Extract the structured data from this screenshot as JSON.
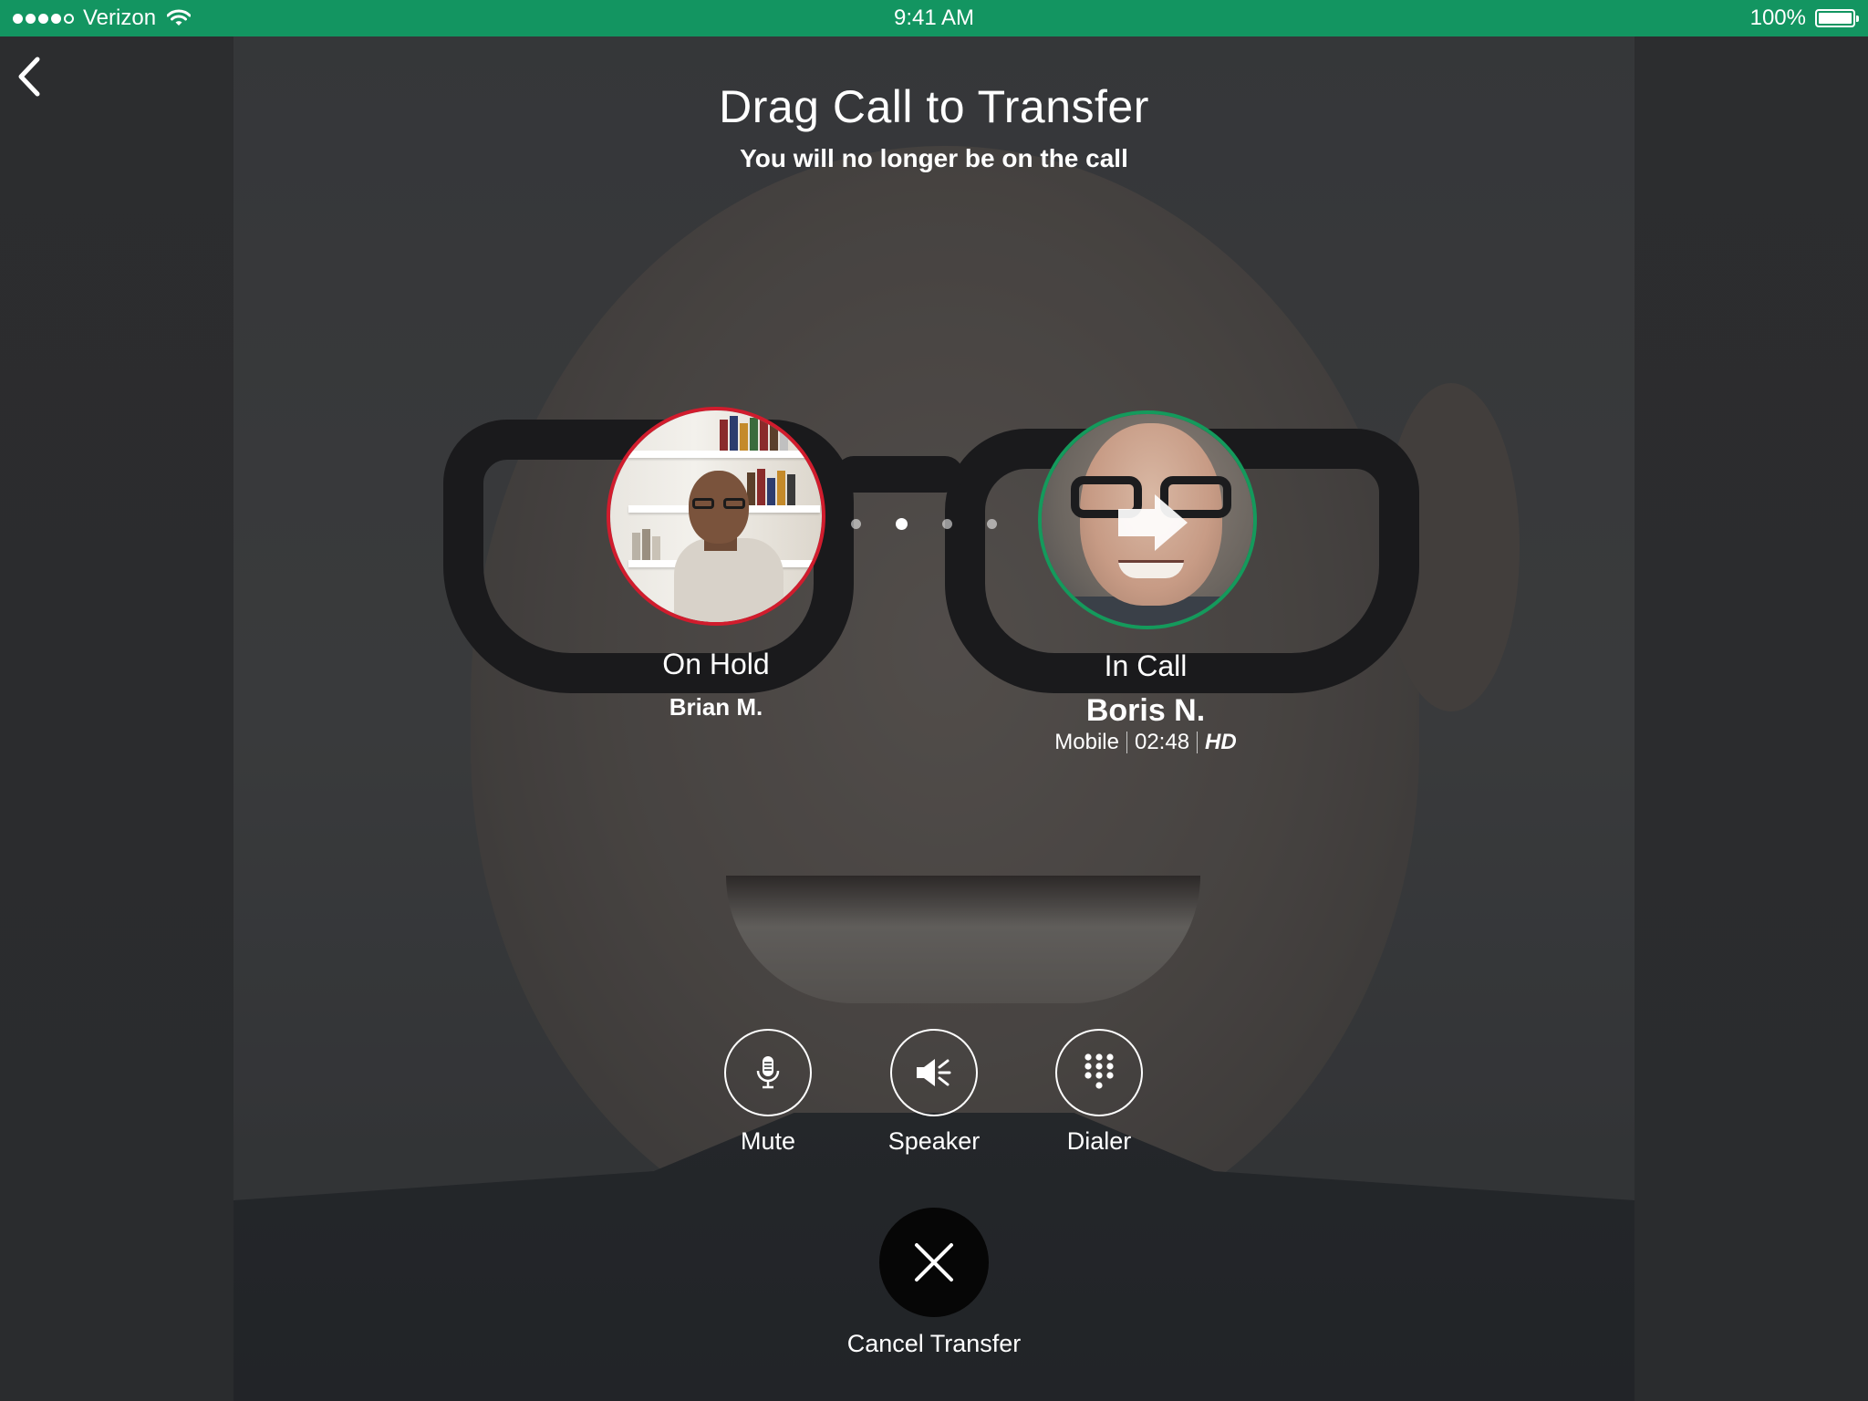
{
  "status_bar": {
    "carrier": "Verizon",
    "time": "9:41 AM",
    "battery": "100%",
    "signal_bars_filled": 4,
    "signal_bars_total": 5
  },
  "header": {
    "title": "Drag Call to Transfer",
    "subtitle": "You will no longer be on the call"
  },
  "on_hold": {
    "state": "On Hold",
    "name": "Brian M."
  },
  "in_call": {
    "state": "In Call",
    "name": "Boris N.",
    "line": "Mobile",
    "duration": "02:48",
    "quality": "HD"
  },
  "pager": {
    "count": 4,
    "active_index": 1
  },
  "controls": {
    "mute": {
      "label": "Mute",
      "icon": "microphone-icon"
    },
    "speaker": {
      "label": "Speaker",
      "icon": "speaker-icon"
    },
    "dialer": {
      "label": "Dialer",
      "icon": "keypad-icon"
    }
  },
  "cancel": {
    "label": "Cancel Transfer",
    "icon": "close-icon"
  },
  "colors": {
    "status_bar": "#139561",
    "on_hold_ring": "#d11c2d",
    "in_call_ring": "#149a5c",
    "cancel_button": "#060606"
  }
}
